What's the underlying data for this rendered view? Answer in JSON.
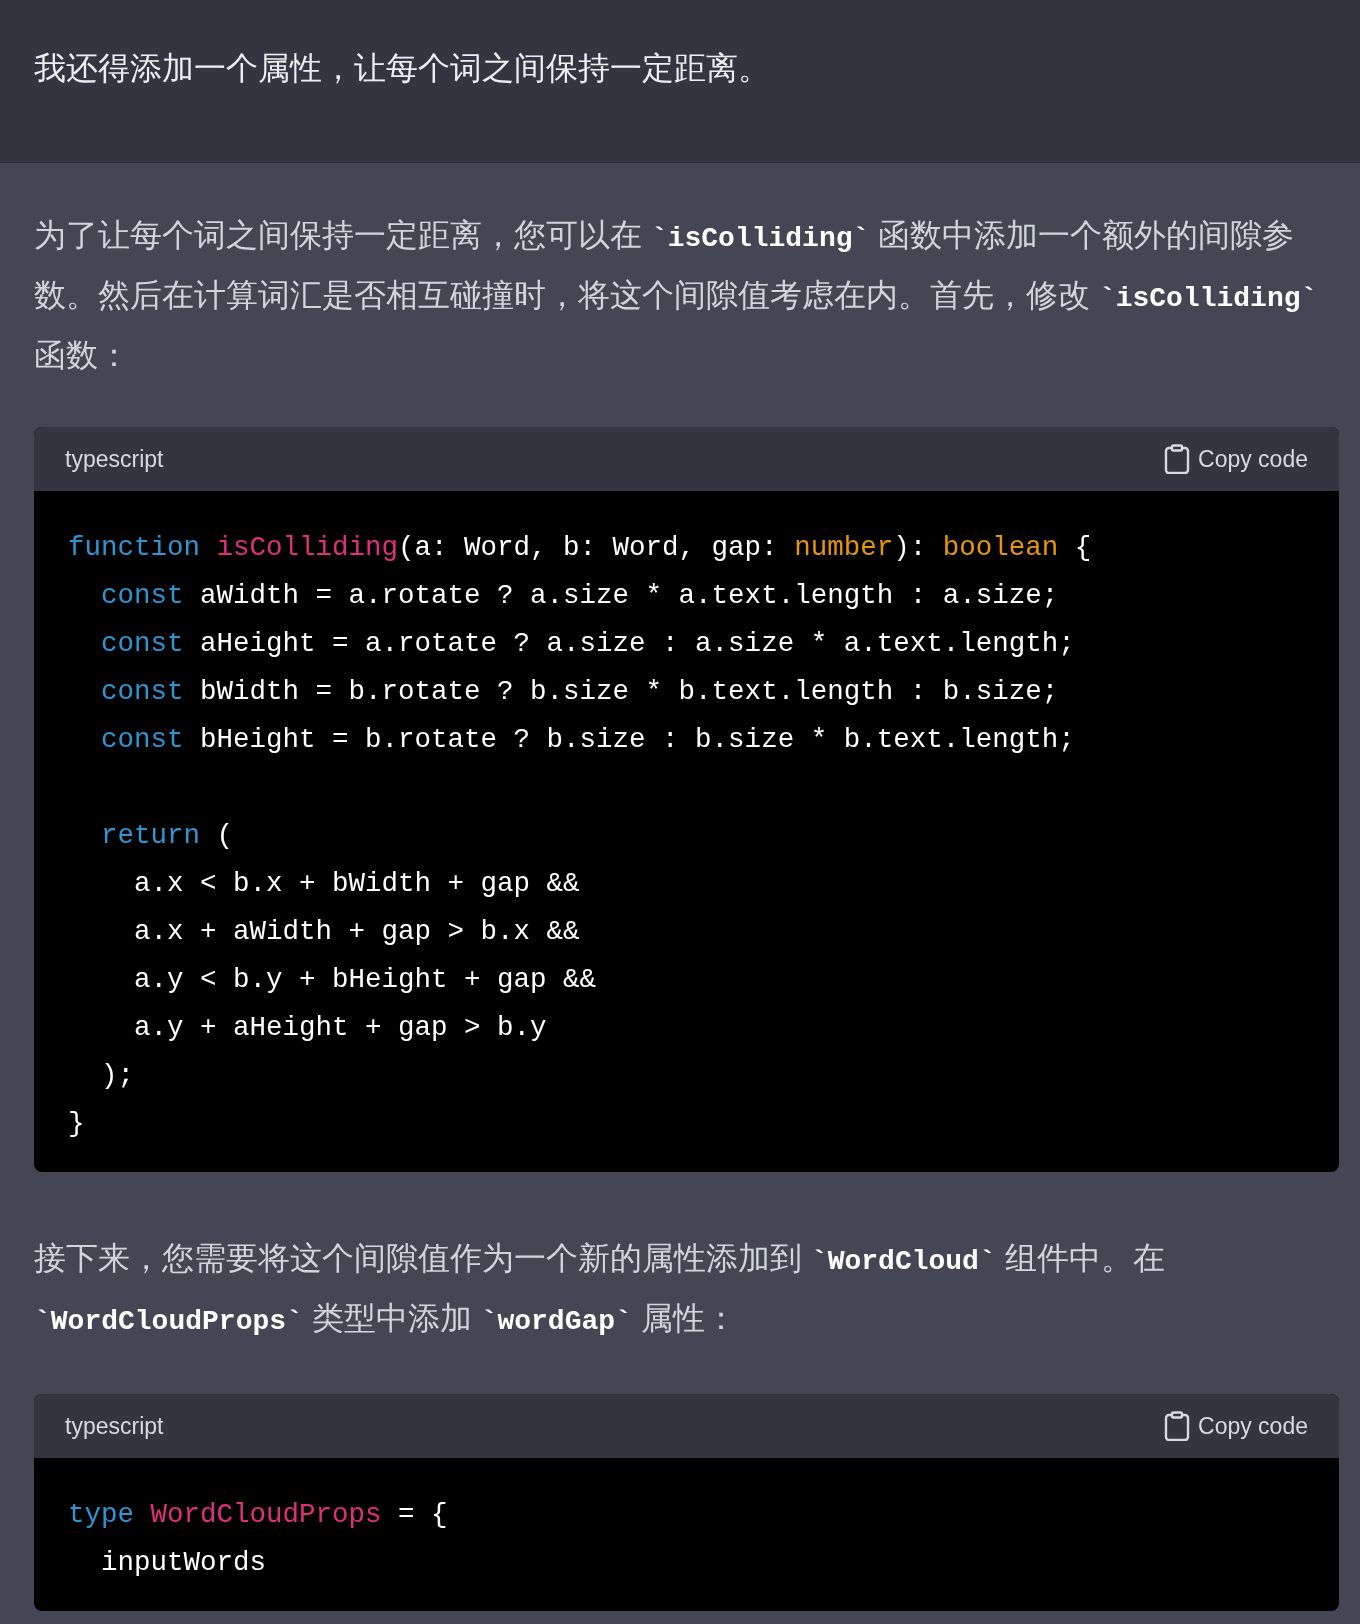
{
  "user_message": {
    "text": "我还得添加一个属性，让每个词之间保持一定距离。"
  },
  "assistant": [
    {
      "kind": "paragraph",
      "segments": [
        {
          "kind": "text",
          "text": "为了让每个词之间保持一定距离，您可以在 "
        },
        {
          "kind": "code",
          "text": "`isColliding`"
        },
        {
          "kind": "text",
          "text": " 函数中添加一个额外的间隙参数。然后在计算词汇是否相互碰撞时，将这个间隙值考虑在内。首先，修改 "
        },
        {
          "kind": "code",
          "text": "`isColliding`"
        },
        {
          "kind": "text",
          "text": " 函数："
        }
      ]
    },
    {
      "kind": "code_block",
      "language": "typescript",
      "copy_label": "Copy code",
      "groups": [
        [
          [
            {
              "kind": "keyword",
              "text": "function "
            },
            {
              "kind": "name",
              "text": "isColliding"
            },
            {
              "kind": "plain",
              "text": "(a: Word, b: Word, gap: "
            },
            {
              "kind": "type",
              "text": "number"
            },
            {
              "kind": "plain",
              "text": "): "
            },
            {
              "kind": "type",
              "text": "boolean"
            },
            {
              "kind": "plain",
              "text": " {"
            }
          ],
          [
            {
              "kind": "keyword",
              "text": "  const"
            },
            {
              "kind": "plain",
              "text": " aWidth = a.rotate ? a.size * a.text.length : a.size;"
            }
          ],
          [
            {
              "kind": "keyword",
              "text": "  const"
            },
            {
              "kind": "plain",
              "text": " aHeight = a.rotate ? a.size : a.size * a.text.length;"
            }
          ],
          [
            {
              "kind": "keyword",
              "text": "  const"
            },
            {
              "kind": "plain",
              "text": " bWidth = b.rotate ? b.size * b.text.length : b.size;"
            }
          ],
          [
            {
              "kind": "keyword",
              "text": "  const"
            },
            {
              "kind": "plain",
              "text": " bHeight = b.rotate ? b.size : b.size * b.text.length;"
            }
          ]
        ],
        [
          [
            {
              "kind": "keyword",
              "text": "  return"
            },
            {
              "kind": "plain",
              "text": " ("
            }
          ],
          [
            {
              "kind": "plain",
              "text": "    a.x < b.x + bWidth + gap &&"
            }
          ],
          [
            {
              "kind": "plain",
              "text": "    a.x + aWidth + gap > b.x &&"
            }
          ],
          [
            {
              "kind": "plain",
              "text": "    a.y < b.y + bHeight + gap &&"
            }
          ],
          [
            {
              "kind": "plain",
              "text": "    a.y + aHeight + gap > b.y"
            }
          ],
          [
            {
              "kind": "plain",
              "text": "  );"
            }
          ],
          [
            {
              "kind": "plain",
              "text": "}"
            }
          ]
        ]
      ]
    },
    {
      "kind": "paragraph",
      "segments": [
        {
          "kind": "text",
          "text": "接下来，您需要将这个间隙值作为一个新的属性添加到 "
        },
        {
          "kind": "code",
          "text": "`WordCloud`"
        },
        {
          "kind": "text",
          "text": " 组件中。在 "
        },
        {
          "kind": "code",
          "text": "`WordCloudProps`"
        },
        {
          "kind": "text",
          "text": " 类型中添加 "
        },
        {
          "kind": "code",
          "text": "`wordGap`"
        },
        {
          "kind": "text",
          "text": " 属性："
        }
      ]
    },
    {
      "kind": "code_block",
      "language": "typescript",
      "copy_label": "Copy code",
      "groups": [
        [
          [
            {
              "kind": "keyword",
              "text": "type "
            },
            {
              "kind": "name",
              "text": "WordCloudProps"
            },
            {
              "kind": "plain",
              "text": " = {"
            }
          ],
          [
            {
              "kind": "plain",
              "text": "  inputWords"
            }
          ]
        ]
      ]
    }
  ]
}
